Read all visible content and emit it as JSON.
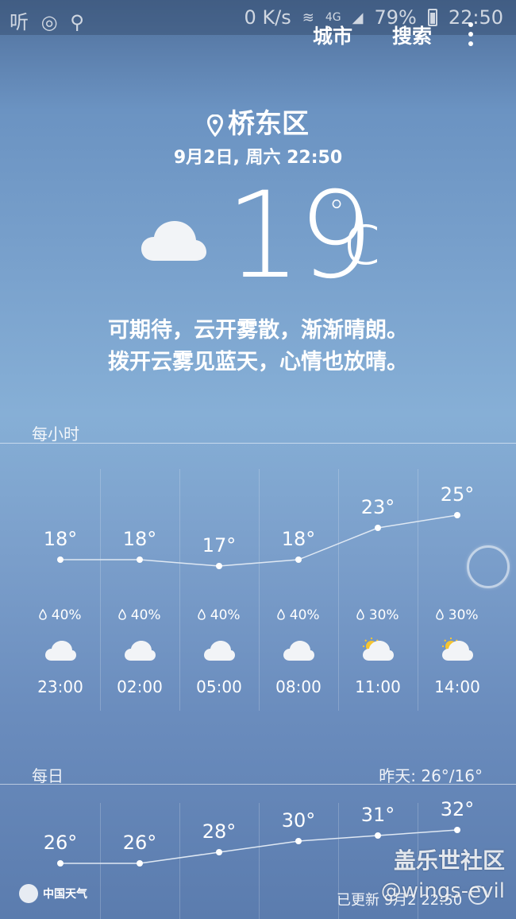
{
  "status_bar": {
    "left_icons": "听 ◎ ⚲",
    "speed": "0 K/s",
    "network": "4G",
    "battery": "79%",
    "time": "22:50"
  },
  "header": {
    "city_button": "城市",
    "search_button": "搜索",
    "location": "桥东区",
    "date": "9月2日, 周六 22:50"
  },
  "current": {
    "temperature": "19",
    "degree": "°",
    "unit": "c",
    "condition_icon": "cloud-icon",
    "description_line1": "可期待，云开雾散，渐渐晴朗。",
    "description_line2": "拨开云雾见蓝天，心情也放晴。"
  },
  "hourly": {
    "label": "每小时",
    "items": [
      {
        "time": "23:00",
        "temp": "18°",
        "temp_value": 18,
        "rain": "40%",
        "icon": "cloud-icon"
      },
      {
        "time": "02:00",
        "temp": "18°",
        "temp_value": 18,
        "rain": "40%",
        "icon": "cloud-icon"
      },
      {
        "time": "05:00",
        "temp": "17°",
        "temp_value": 17,
        "rain": "40%",
        "icon": "cloud-icon"
      },
      {
        "time": "08:00",
        "temp": "18°",
        "temp_value": 18,
        "rain": "40%",
        "icon": "cloud-icon"
      },
      {
        "time": "11:00",
        "temp": "23°",
        "temp_value": 23,
        "rain": "30%",
        "icon": "partly-sunny-icon"
      },
      {
        "time": "14:00",
        "temp": "25°",
        "temp_value": 25,
        "rain": "30%",
        "icon": "partly-sunny-icon"
      }
    ]
  },
  "daily": {
    "label": "每日",
    "yesterday": "昨天: 26°/16°",
    "items": [
      {
        "temp": "26°",
        "temp_value": 26
      },
      {
        "temp": "26°",
        "temp_value": 26
      },
      {
        "temp": "28°",
        "temp_value": 28
      },
      {
        "temp": "30°",
        "temp_value": 30
      },
      {
        "temp": "31°",
        "temp_value": 31
      },
      {
        "temp": "32°",
        "temp_value": 32
      }
    ]
  },
  "footer": {
    "logo_text": "中国天气",
    "updated": "已更新 9月2 22:50"
  },
  "watermark": {
    "line1": "盖乐世社区",
    "line2": "@wings-evil"
  },
  "colors": {
    "line": "#dfe8f3",
    "sun": "#f5c531",
    "cloud": "#f2f4f7"
  }
}
